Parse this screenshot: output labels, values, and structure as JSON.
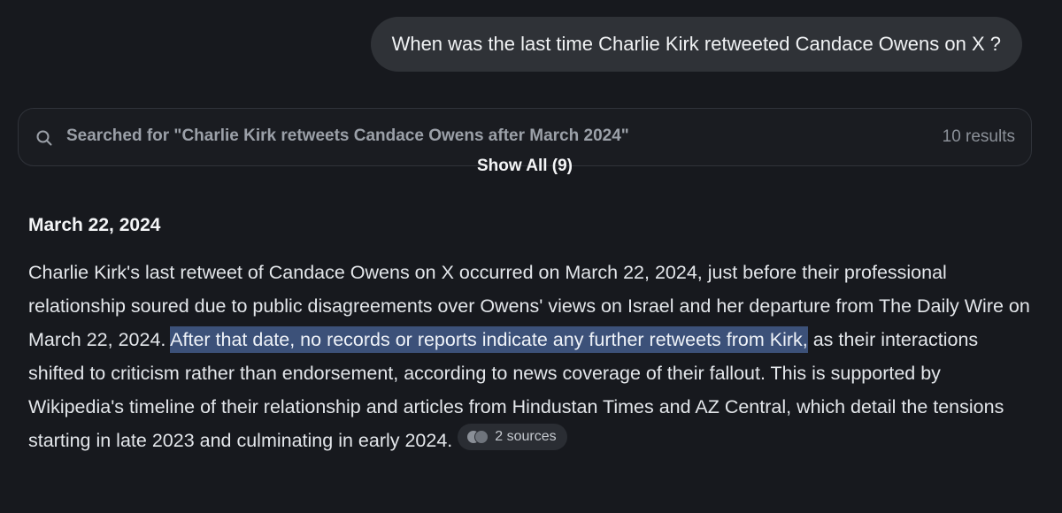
{
  "user_message": "When was the last time Charlie Kirk retweeted Candace Owens on X ?",
  "search": {
    "icon": "search-icon",
    "query": "Searched for \"Charlie Kirk retweets Candace Owens after March 2024\"",
    "result_count": "10 results",
    "show_all_label": "Show All (9)"
  },
  "answer": {
    "heading": "March 22, 2024",
    "text_before_highlight": "Charlie Kirk's last retweet of Candace Owens on X occurred on March 22, 2024, just before their professional relationship soured due to public disagreements over Owens' views on Israel and her departure from The Daily Wire on March 22, 2024. ",
    "highlighted_text": "After that date, no records or reports indicate any further retweets from Kirk,",
    "text_after_highlight": " as their interactions shifted to criticism rather than endorsement, according to news coverage of their fallout. This is supported by Wikipedia's timeline of their relationship and articles from Hindustan Times and AZ Central, which detail the tensions starting in late 2023 and culminating in early 2024.",
    "sources_label": "2 sources"
  },
  "colors": {
    "background": "#17191e",
    "user_bubble": "#2f3237",
    "highlight": "#3c5179"
  }
}
